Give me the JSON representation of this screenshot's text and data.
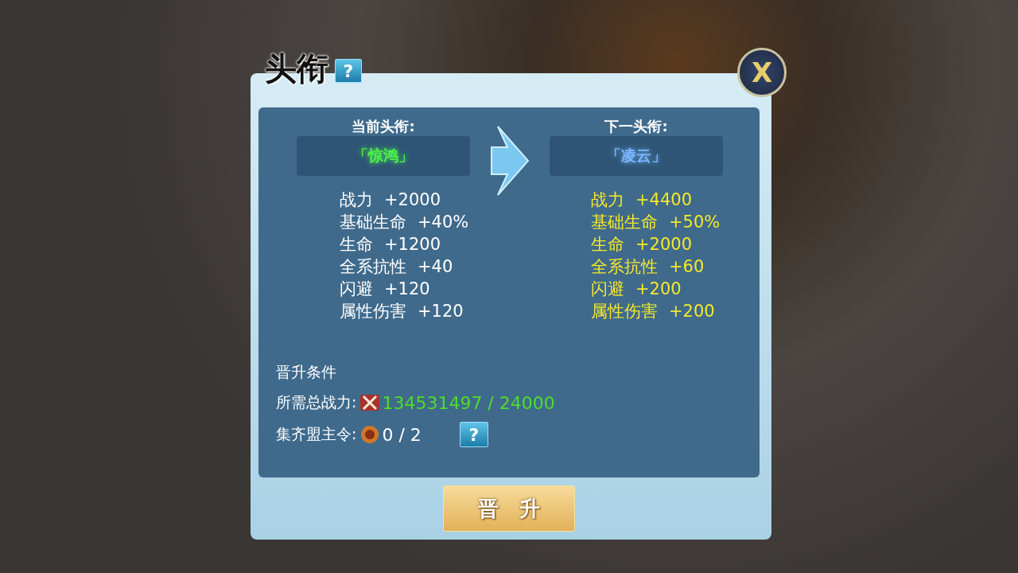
{
  "dialog": {
    "title": "头衔",
    "title_help": "?",
    "close": "X"
  },
  "titles": [
    {
      "kind": "current",
      "heading": "当前头衔:",
      "name": "「惊鸿」",
      "color": "#4cf04c",
      "stats": [
        {
          "label": "战力",
          "value": "+2000"
        },
        {
          "label": "基础生命",
          "value": "+40%"
        },
        {
          "label": "生命",
          "value": "+1200"
        },
        {
          "label": "全系抗性",
          "value": "+40"
        },
        {
          "label": "闪避",
          "value": "+120"
        },
        {
          "label": "属性伤害",
          "value": "+120"
        }
      ]
    },
    {
      "kind": "next",
      "heading": "下一头衔:",
      "name": "「凌云」",
      "color": "#7ab8ff",
      "stats": [
        {
          "label": "战力",
          "value": "+4400"
        },
        {
          "label": "基础生命",
          "value": "+50%"
        },
        {
          "label": "生命",
          "value": "+2000"
        },
        {
          "label": "全系抗性",
          "value": "+60"
        },
        {
          "label": "闪避",
          "value": "+200"
        },
        {
          "label": "属性伤害",
          "value": "+200"
        }
      ]
    }
  ],
  "requirements": {
    "heading": "晋升条件",
    "rows": [
      {
        "kind": "power",
        "label": "所需总战力:",
        "value": "134531497 / 24000",
        "met": true
      },
      {
        "kind": "token",
        "label": "集齐盟主令:",
        "value": "0 / 2",
        "met": false,
        "help": "?"
      }
    ]
  },
  "promote_button": "晋　升"
}
